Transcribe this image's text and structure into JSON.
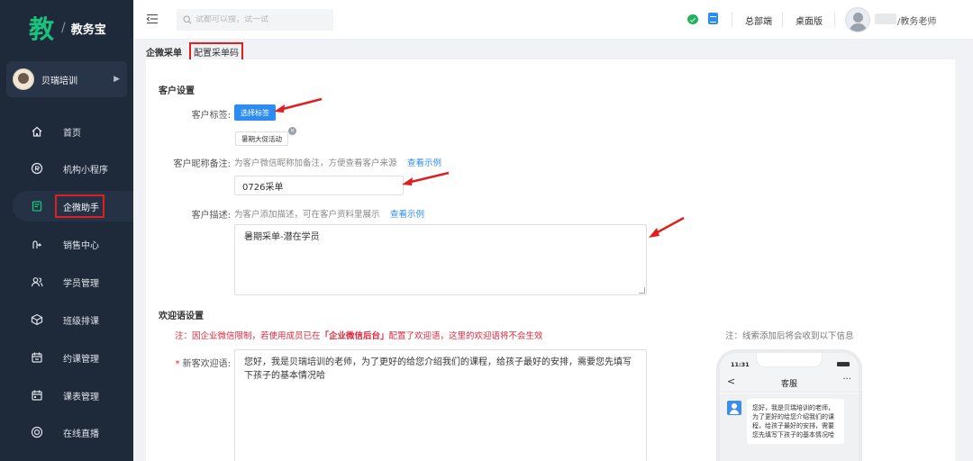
{
  "app": {
    "logo_char": "教",
    "logo_slash": "/",
    "logo_name": "教务宝"
  },
  "org": {
    "name": "贝瑞培训"
  },
  "nav": [
    {
      "label": "首页",
      "icon": "home-icon"
    },
    {
      "label": "机构小程序",
      "icon": "mini-program-icon"
    },
    {
      "label": "企微助手",
      "icon": "wecom-assistant-icon",
      "active": true
    },
    {
      "label": "销售中心",
      "icon": "sales-icon"
    },
    {
      "label": "学员管理",
      "icon": "students-icon"
    },
    {
      "label": "班级排课",
      "icon": "class-schedule-icon"
    },
    {
      "label": "约课管理",
      "icon": "booking-icon"
    },
    {
      "label": "课表管理",
      "icon": "calendar-icon"
    },
    {
      "label": "在线直播",
      "icon": "live-icon"
    }
  ],
  "topbar": {
    "search_placeholder": "试都可以搜，试一试",
    "headquarters": "总部端",
    "desktop": "桌面版",
    "user_suffix": "/教务老师"
  },
  "breadcrumb": {
    "parent": "企微采单",
    "current": "配置采单码"
  },
  "customer_settings": {
    "title": "客户设置",
    "tag_label": "客户标签:",
    "select_tag_button": "选择标签",
    "tag": "暑期大促活动",
    "nickname_label": "客户昵称备注:",
    "nickname_hint": "为客户微信昵称加备注，方便查看客户来源",
    "nickname_example": "查看示例",
    "nickname_value": "0726采单",
    "desc_label": "客户描述:",
    "desc_hint": "为客户添加描述，可在客户资料里展示",
    "desc_example": "查看示例",
    "desc_value": "暑期采单-潜在学员"
  },
  "welcome_settings": {
    "title": "欢迎语设置",
    "warn_prefix": "注：因企业微信限制，若使用成员已在",
    "warn_bold": "「企业微信后台」",
    "warn_suffix": "配置了欢迎语，这里的欢迎语将不会生效",
    "right_note": "注：线索添加后将会收到以下信息",
    "new_label": "新客欢迎语:",
    "new_value": "您好，我是贝瑞培训的老师，为了更好的给您介绍我们的课程，给孩子最好的安排，需要您先填写下孩子的基本情况哈"
  },
  "phone": {
    "time": "11:31",
    "title": "客服",
    "back": "<",
    "more": "···",
    "message": "您好，我是贝瑞培训的老师，为了更好的给您介绍我们的课程，给孩子最好的安排，需要您先填写下孩子的基本情况哈"
  },
  "colors": {
    "sidebar": "#1e2a3a",
    "brand_green": "#19c37d",
    "primary": "#2d8cf0",
    "annotation_red": "#e02020"
  }
}
